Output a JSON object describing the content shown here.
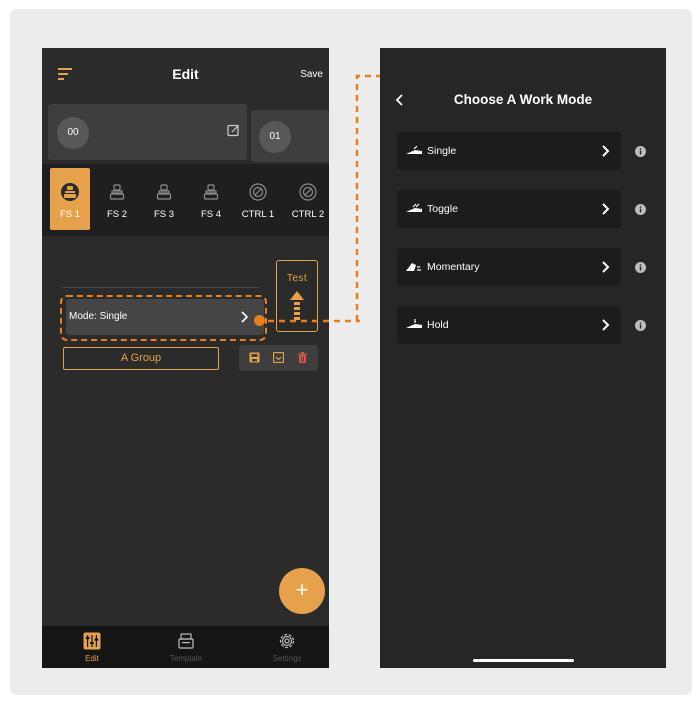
{
  "editor": {
    "title": "Edit",
    "save_label": "Save",
    "presets": [
      {
        "number": "00"
      },
      {
        "number": "01"
      }
    ],
    "footswitches": [
      {
        "label": "FS 1",
        "icon": "footswitch-icon",
        "active": true
      },
      {
        "label": "FS 2",
        "icon": "footswitch-icon",
        "active": false
      },
      {
        "label": "FS 3",
        "icon": "footswitch-icon",
        "active": false
      },
      {
        "label": "FS 4",
        "icon": "footswitch-icon",
        "active": false
      },
      {
        "label": "CTRL 1",
        "icon": "knob-icon",
        "active": false
      },
      {
        "label": "CTRL 2",
        "icon": "knob-icon",
        "active": false
      }
    ],
    "test_label": "Test",
    "mode_label": "Mode: Single",
    "group_label": "A Group",
    "fab_symbol": "+",
    "tabs": [
      {
        "label": "Edit",
        "icon": "sliders-icon",
        "active": true
      },
      {
        "label": "Template",
        "icon": "template-icon",
        "active": false
      },
      {
        "label": "Settings",
        "icon": "gear-icon",
        "active": false
      }
    ]
  },
  "work_mode": {
    "title": "Choose A Work Mode",
    "modes": [
      {
        "label": "Single",
        "icon": "single-mode-icon"
      },
      {
        "label": "Toggle",
        "icon": "toggle-mode-icon"
      },
      {
        "label": "Momentary",
        "icon": "momentary-mode-icon"
      },
      {
        "label": "Hold",
        "icon": "hold-mode-icon"
      }
    ]
  },
  "colors": {
    "accent": "#e6a24a",
    "highlight": "#e67e22",
    "background": "#2b2b2c",
    "delete": "#d9534f"
  }
}
